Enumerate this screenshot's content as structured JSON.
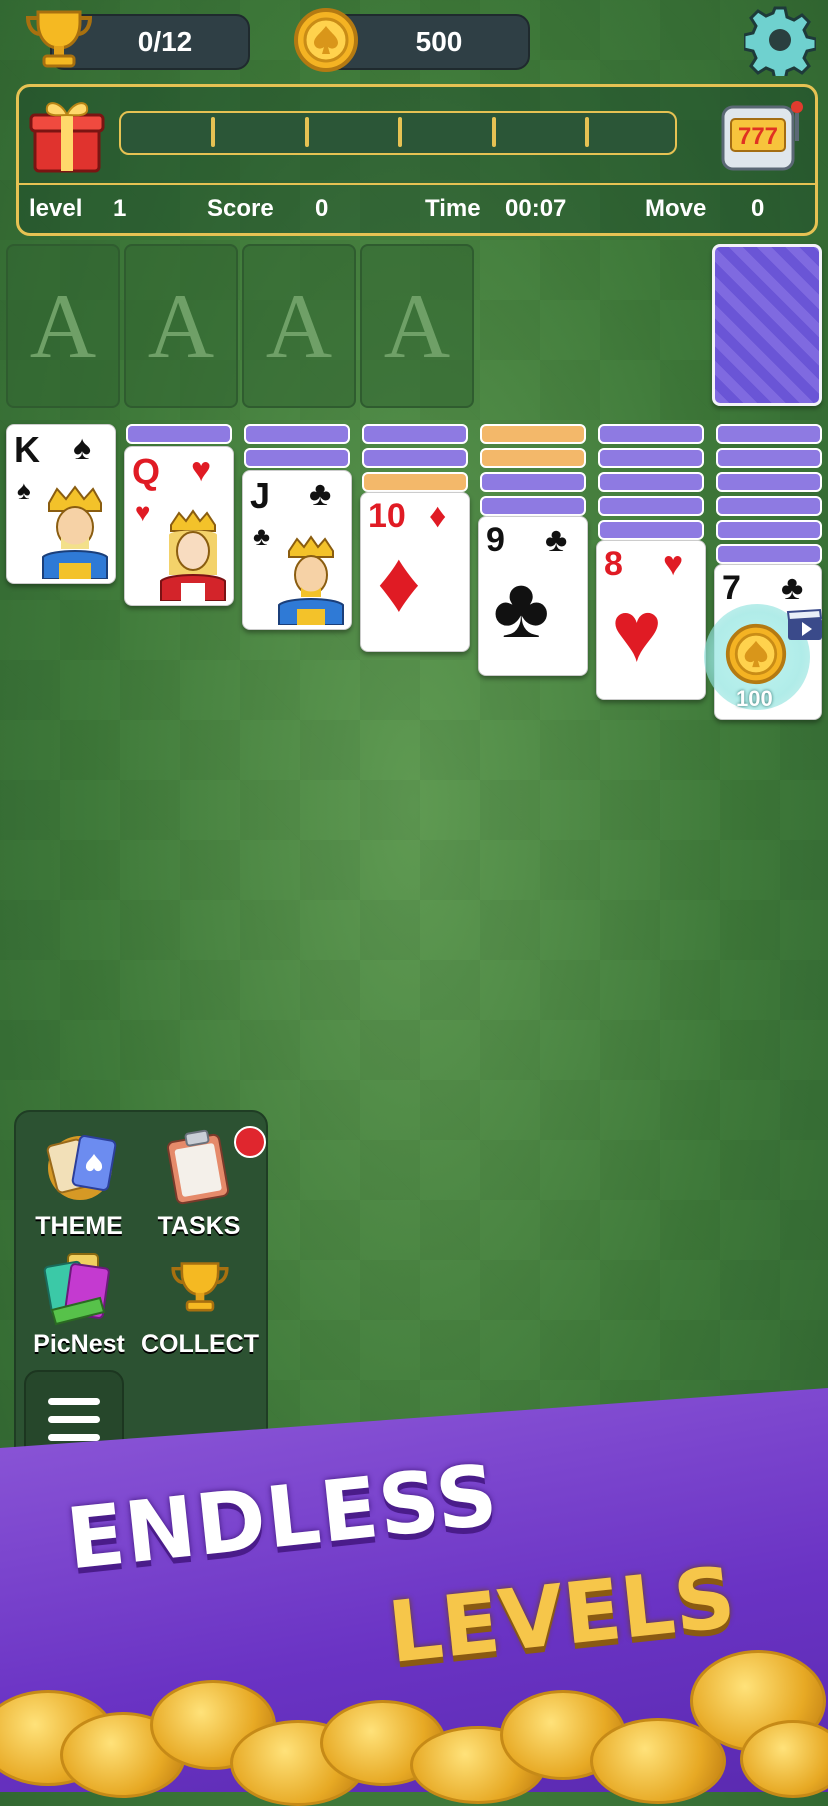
{
  "hud": {
    "trophy_progress": "0/12",
    "coins": "500"
  },
  "stats": {
    "level_label": "level",
    "level_value": "1",
    "score_label": "Score",
    "score_value": "0",
    "time_label": "Time",
    "time_value": "00:07",
    "move_label": "Move",
    "move_value": "0"
  },
  "foundations": [
    "A",
    "A",
    "A",
    "A"
  ],
  "tableau": [
    {
      "rank": "K",
      "suit": "♠",
      "color": "black",
      "face": true,
      "backs": []
    },
    {
      "rank": "Q",
      "suit": "♥",
      "color": "red",
      "face": true,
      "backs": [
        "purple"
      ]
    },
    {
      "rank": "J",
      "suit": "♣",
      "color": "black",
      "face": true,
      "backs": [
        "purple",
        "purple"
      ]
    },
    {
      "rank": "10",
      "suit": "♦",
      "color": "red",
      "face": false,
      "backs": [
        "purple",
        "purple",
        "orange"
      ]
    },
    {
      "rank": "9",
      "suit": "♣",
      "color": "black",
      "face": false,
      "backs": [
        "orange",
        "orange",
        "purple",
        "purple"
      ]
    },
    {
      "rank": "8",
      "suit": "♥",
      "color": "red",
      "face": false,
      "backs": [
        "purple",
        "purple",
        "purple",
        "purple",
        "purple"
      ]
    },
    {
      "rank": "7",
      "suit": "♣",
      "color": "black",
      "face": false,
      "backs": [
        "purple",
        "purple",
        "purple",
        "purple",
        "purple",
        "purple"
      ]
    }
  ],
  "reward_bubble": "100",
  "sidebar": {
    "theme": "THEME",
    "tasks": "TASKS",
    "picnest": "PicNest",
    "collect": "COLLECT"
  },
  "banner": {
    "line1": "ENDLESS",
    "line2": "LEVELS"
  }
}
